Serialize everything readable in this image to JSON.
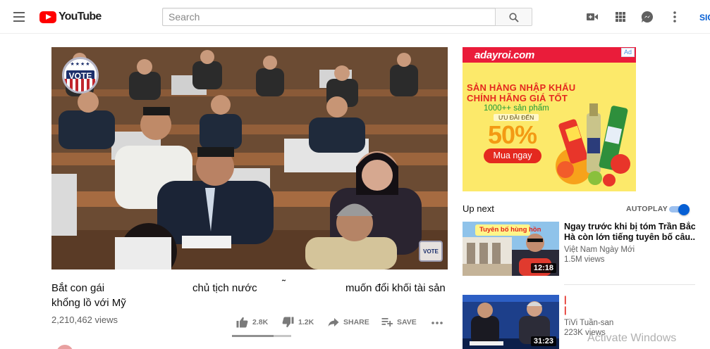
{
  "masthead": {
    "logo_text": "YouTube",
    "search_placeholder": "Search",
    "signin_label": "SIG",
    "icons": [
      "menu-icon",
      "youtube-logo-icon",
      "search-icon",
      "create-video-icon",
      "apps-grid-icon",
      "messages-icon",
      "more-vert-icon"
    ]
  },
  "player": {
    "watermark_top_left": "VOTE",
    "watermark_bottom_right": "VOTE"
  },
  "video": {
    "title_parts": [
      "Bắt con gái",
      "chủ tịch nước",
      "˜",
      "muốn đổi khối tài sản"
    ],
    "title_line2": "khổng lồ với Mỹ",
    "views": "2,210,462 views",
    "likes": "2.8K",
    "dislikes": "1.2K",
    "share_label": "SHARE",
    "save_label": "SAVE",
    "like_ratio": 0.7
  },
  "ad": {
    "brand": "adayroi.com",
    "badge": "Ad",
    "line1": "SẢN HÀNG NHẬP KHẨU",
    "line2": "CHÍNH HÃNG GIÁ TỐT",
    "line3": "1000++ sản phẩm",
    "line4": "ƯU ĐÃI ĐẾN",
    "discount": "50%",
    "cta": "Mua ngay",
    "colors": {
      "header": "#ea1c3a",
      "background": "#fce96a",
      "discount": "#f39a14"
    }
  },
  "sidebar": {
    "up_next_label": "Up next",
    "autoplay_label": "AUTOPLAY",
    "autoplay_on": true,
    "recommendations": [
      {
        "title_lines": [
          "Ngay trước khi bị tóm Trần Bắc",
          "Hà còn lớn tiếng tuyên bố câu..."
        ],
        "thumb_caption": "Tuyên bố hùng hồn",
        "channel": "Việt Nam Ngày Mới",
        "views": "1.5M views",
        "duration": "12:18"
      },
      {
        "title_lines": [
          "|",
          "|"
        ],
        "channel": "TiVi Tuần-san",
        "views": "223K views",
        "duration": "31:23"
      }
    ]
  },
  "system": {
    "activate_windows": "Activate Windows"
  }
}
